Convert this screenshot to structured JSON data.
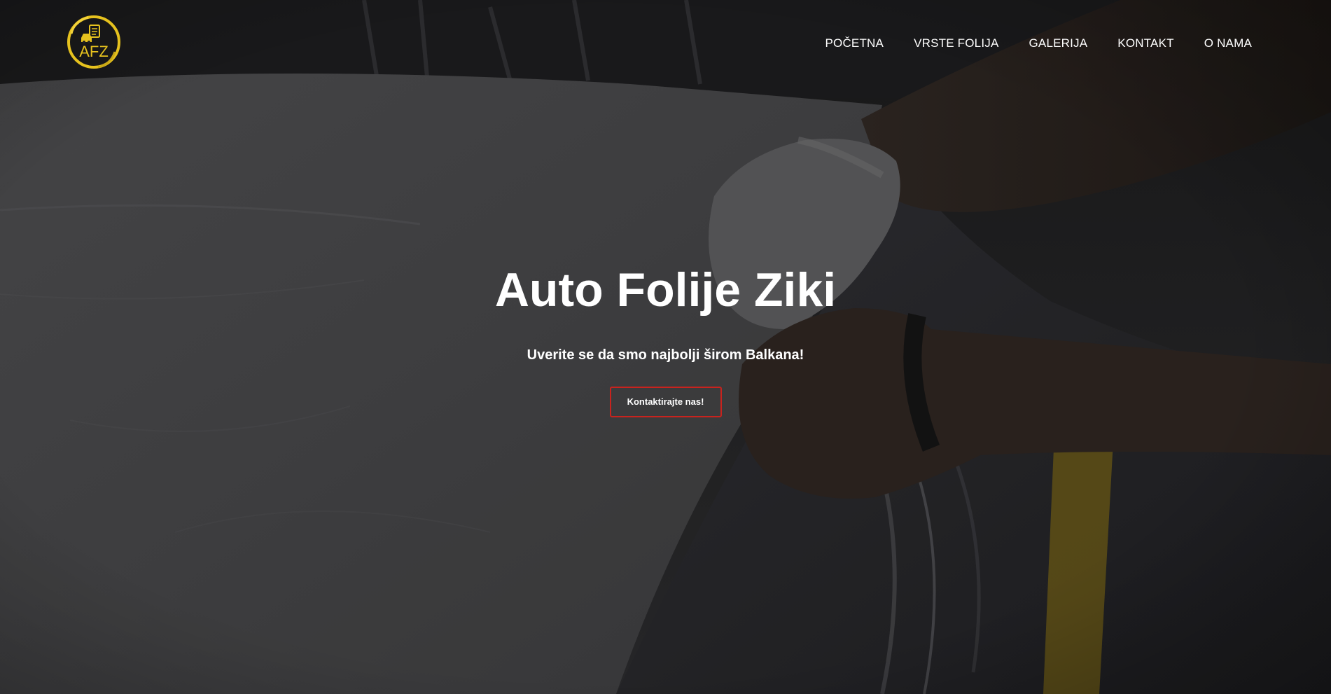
{
  "logo": {
    "text": "AFZ",
    "icon": "car-document-icon",
    "ring_color": "#e6c21e"
  },
  "nav": {
    "items": [
      {
        "label": "POČETNA"
      },
      {
        "label": "VRSTE FOLIJA"
      },
      {
        "label": "GALERIJA"
      },
      {
        "label": "KONTAKT"
      },
      {
        "label": "O NAMA"
      }
    ]
  },
  "hero": {
    "title": "Auto Folije Ziki",
    "subtitle": "Uverite se da smo najbolji širom Balkana!",
    "cta_label": "Kontaktirajte nas!",
    "cta_border_color": "#c8231e",
    "background": "photo-hands-applying-car-wrap"
  }
}
